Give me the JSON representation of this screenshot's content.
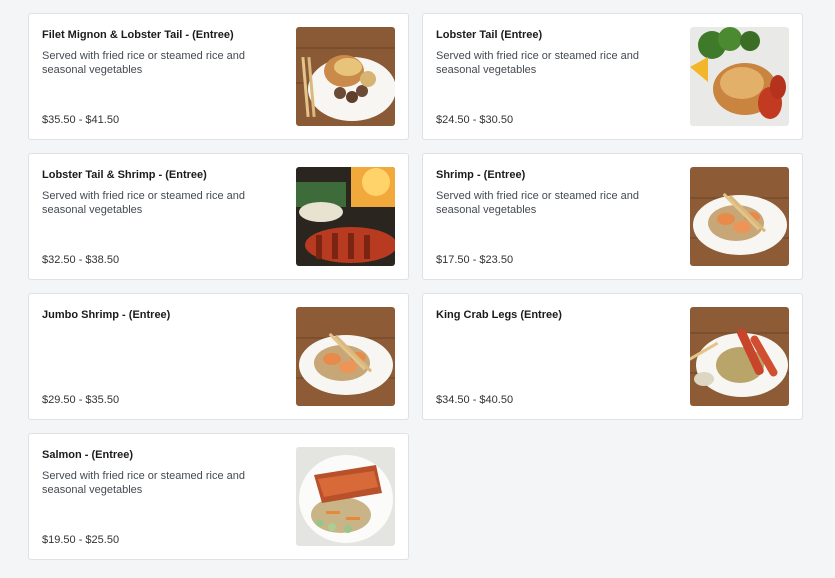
{
  "menu_items": [
    {
      "title": "Filet Mignon & Lobster Tail - (Entree)",
      "description": "Served with fried rice or steamed rice and seasonal vegetables",
      "price": "$35.50 - $41.50",
      "image": "filet-mignon-lobster-tail-photo"
    },
    {
      "title": "Lobster Tail (Entree)",
      "description": "Served with fried rice or steamed rice and seasonal vegetables",
      "price": "$24.50 - $30.50",
      "image": "lobster-tail-photo"
    },
    {
      "title": "Lobster Tail & Shrimp - (Entree)",
      "description": "Served with fried rice or steamed rice and seasonal vegetables",
      "price": "$32.50 - $38.50",
      "image": "lobster-tail-shrimp-photo"
    },
    {
      "title": "Shrimp - (Entree)",
      "description": "Served with fried rice or steamed rice and seasonal vegetables",
      "price": "$17.50 - $23.50",
      "image": "shrimp-photo"
    },
    {
      "title": "Jumbo Shrimp - (Entree)",
      "description": "",
      "price": "$29.50 - $35.50",
      "image": "jumbo-shrimp-photo"
    },
    {
      "title": "King Crab Legs (Entree)",
      "description": "",
      "price": "$34.50 - $40.50",
      "image": "king-crab-legs-photo"
    },
    {
      "title": "Salmon - (Entree)",
      "description": "Served with fried rice or steamed rice and seasonal vegetables",
      "price": "$19.50 - $25.50",
      "image": "salmon-photo"
    }
  ],
  "colors": {
    "page_background": "#f4f5f7",
    "card_background": "#ffffff",
    "card_border": "#dfe1e4",
    "wood": "#8a5a36",
    "plate": "#f7f6f2"
  }
}
